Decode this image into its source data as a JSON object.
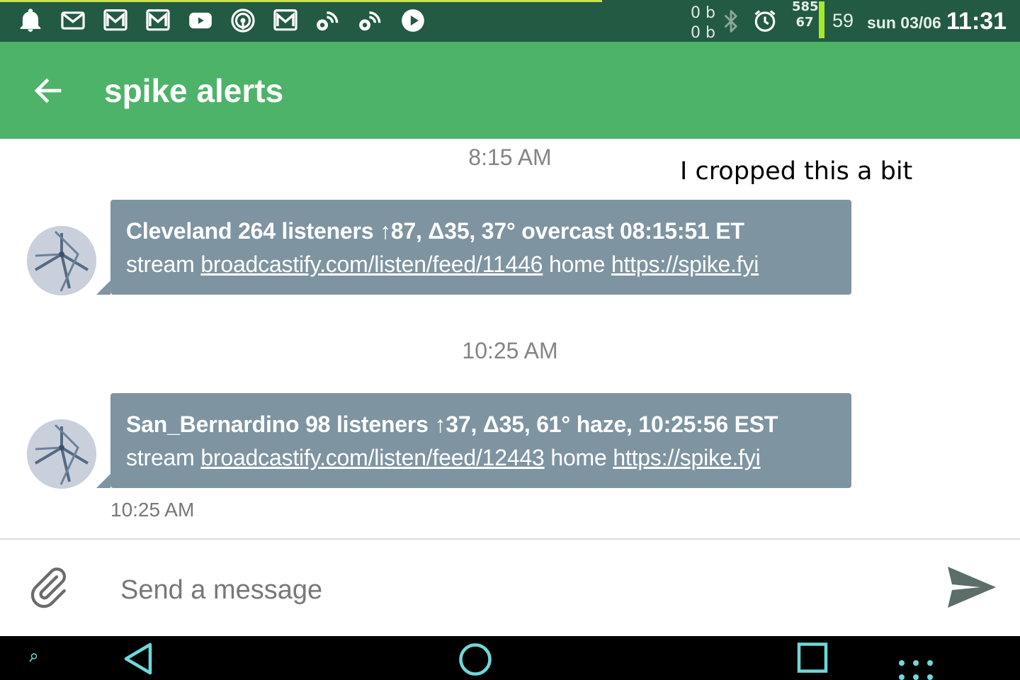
{
  "status_bar": {
    "net_up": "0 b",
    "net_down": "0 b",
    "signal_top": "585",
    "signal_bottom": "67",
    "battery": "59",
    "date": "sun 03/06",
    "time": "11:31",
    "notification_icons": [
      "bell-icon",
      "gmail-icon",
      "gmail-icon",
      "gmail-icon",
      "youtube-icon",
      "podcast-icon",
      "gmail-icon",
      "rss-icon",
      "rss-icon",
      "play-icon"
    ],
    "colors": {
      "background": "#235a43",
      "battery_bar": "#a6e82a",
      "progress_line": "#c8e04a"
    }
  },
  "app_bar": {
    "title": "spike alerts",
    "color": "#4cb369"
  },
  "annotation": "I cropped this a bit",
  "messages": [
    {
      "time_separator": "8:15 AM",
      "line1": "Cleveland 264 listeners ↑87, Δ35, 37° overcast  08:15:51 ET",
      "prefix_stream": "stream",
      "stream_link": "broadcastify.com/listen/feed/11446",
      "prefix_home": "home",
      "home_link": "https://spike.fyi"
    },
    {
      "time_separator": "10:25 AM",
      "line1": "San_Bernardino 98 listeners ↑37, Δ35, 61° haze, 10:25:56 EST",
      "prefix_stream": "stream",
      "stream_link": "broadcastify.com/listen/feed/12443",
      "prefix_home": "home",
      "home_link": "https://spike.fyi",
      "timestamp": "10:25 AM"
    }
  ],
  "bubble_color": "#7e94a1",
  "composer": {
    "placeholder": "Send a message",
    "value": ""
  },
  "nav_bar": {
    "accent": "#6fd8d8"
  }
}
